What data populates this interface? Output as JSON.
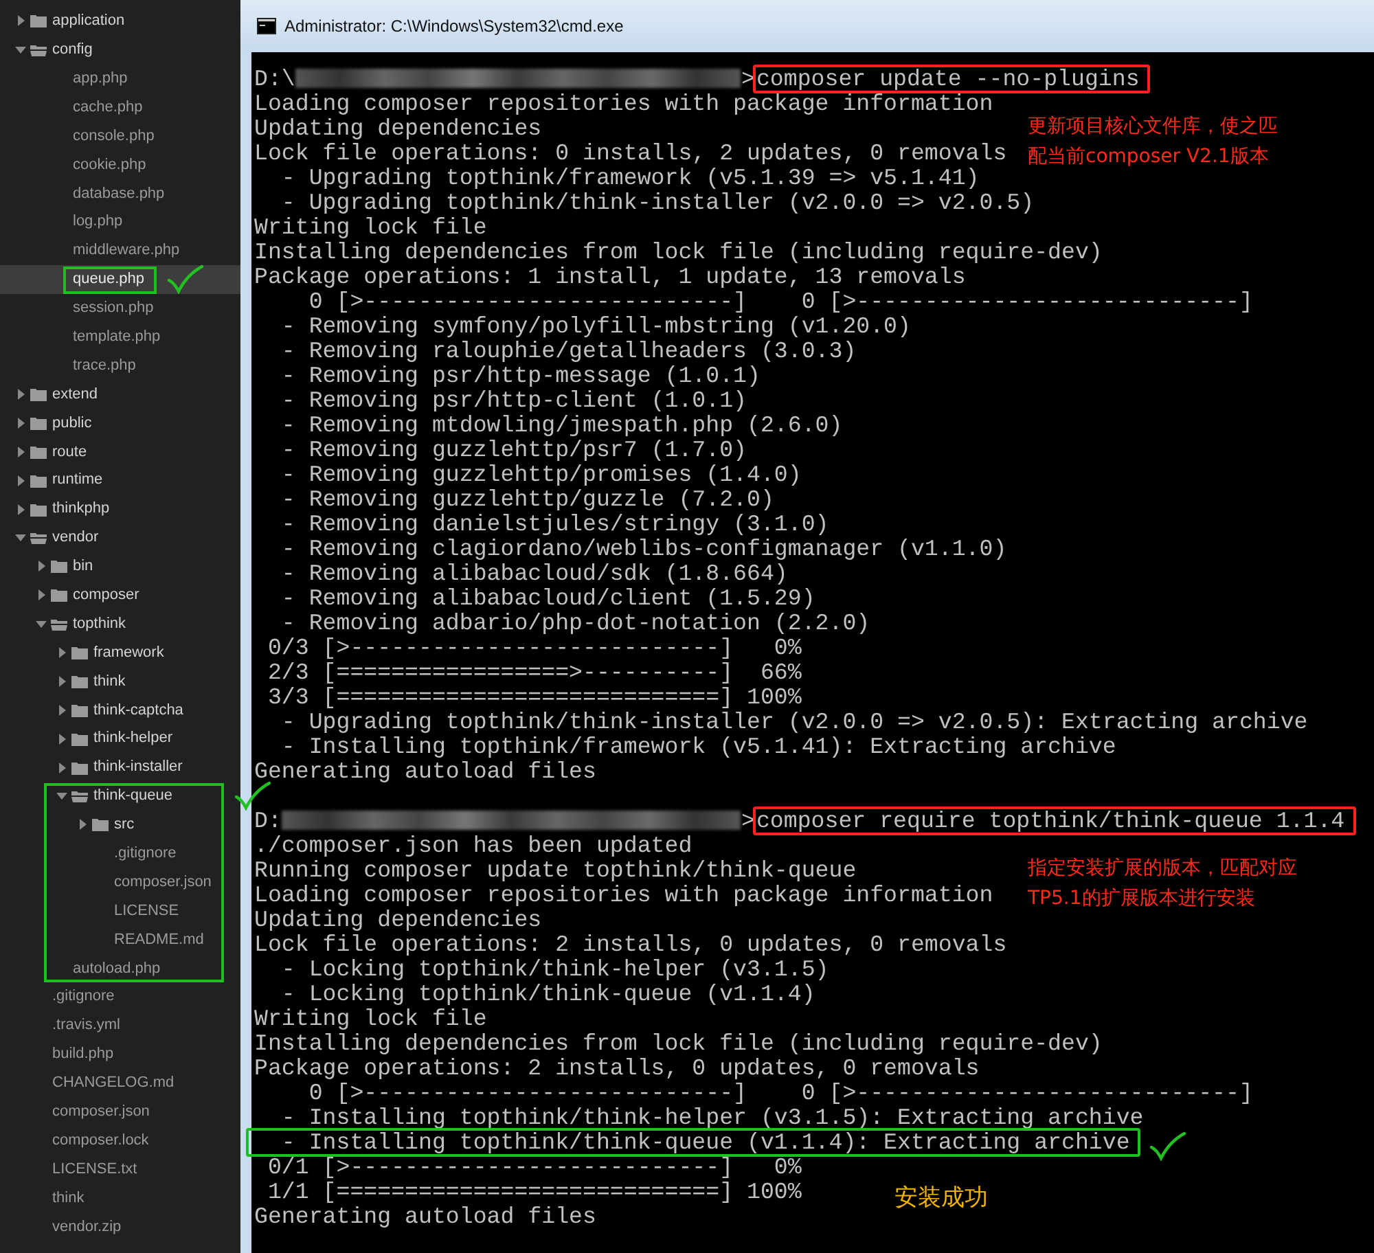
{
  "sidebar": {
    "tree": [
      {
        "name": "application",
        "kind": "folder",
        "expanded": false,
        "selected": false
      },
      {
        "name": "config",
        "kind": "folder",
        "expanded": true,
        "selected": false,
        "children": [
          {
            "name": "app.php",
            "kind": "file",
            "selected": false
          },
          {
            "name": "cache.php",
            "kind": "file",
            "selected": false
          },
          {
            "name": "console.php",
            "kind": "file",
            "selected": false
          },
          {
            "name": "cookie.php",
            "kind": "file",
            "selected": false
          },
          {
            "name": "database.php",
            "kind": "file",
            "selected": false
          },
          {
            "name": "log.php",
            "kind": "file",
            "selected": false
          },
          {
            "name": "middleware.php",
            "kind": "file",
            "selected": false
          },
          {
            "name": "queue.php",
            "kind": "file",
            "selected": true,
            "boxed": true,
            "check": true
          },
          {
            "name": "session.php",
            "kind": "file",
            "selected": false
          },
          {
            "name": "template.php",
            "kind": "file",
            "selected": false
          },
          {
            "name": "trace.php",
            "kind": "file",
            "selected": false
          }
        ]
      },
      {
        "name": "extend",
        "kind": "folder",
        "expanded": false,
        "selected": false
      },
      {
        "name": "public",
        "kind": "folder",
        "expanded": false,
        "selected": false
      },
      {
        "name": "route",
        "kind": "folder",
        "expanded": false,
        "selected": false
      },
      {
        "name": "runtime",
        "kind": "folder",
        "expanded": false,
        "selected": false
      },
      {
        "name": "thinkphp",
        "kind": "folder",
        "expanded": false,
        "selected": false
      },
      {
        "name": "vendor",
        "kind": "folder",
        "expanded": true,
        "selected": false,
        "children": [
          {
            "name": "bin",
            "kind": "folder",
            "expanded": false,
            "selected": false
          },
          {
            "name": "composer",
            "kind": "folder",
            "expanded": false,
            "selected": false
          },
          {
            "name": "topthink",
            "kind": "folder",
            "expanded": true,
            "selected": false,
            "children": [
              {
                "name": "framework",
                "kind": "folder",
                "expanded": false,
                "selected": false
              },
              {
                "name": "think",
                "kind": "folder",
                "expanded": false,
                "selected": false
              },
              {
                "name": "think-captcha",
                "kind": "folder",
                "expanded": false,
                "selected": false
              },
              {
                "name": "think-helper",
                "kind": "folder",
                "expanded": false,
                "selected": false
              },
              {
                "name": "think-installer",
                "kind": "folder",
                "expanded": false,
                "selected": false
              },
              {
                "name": "think-queue",
                "kind": "folder",
                "expanded": true,
                "selected": false,
                "boxed": true,
                "check": true,
                "children": [
                  {
                    "name": "src",
                    "kind": "folder",
                    "expanded": false,
                    "selected": false,
                    "boxed": true
                  },
                  {
                    "name": ".gitignore",
                    "kind": "file",
                    "selected": false,
                    "boxed": true
                  },
                  {
                    "name": "composer.json",
                    "kind": "file",
                    "selected": false,
                    "boxed": true
                  },
                  {
                    "name": "LICENSE",
                    "kind": "file",
                    "selected": false,
                    "boxed": true
                  },
                  {
                    "name": "README.md",
                    "kind": "file",
                    "selected": false,
                    "boxed": true
                  }
                ]
              }
            ]
          },
          {
            "name": "autoload.php",
            "kind": "file",
            "selected": false,
            "boxed": true
          }
        ]
      },
      {
        "name": ".gitignore",
        "kind": "file",
        "selected": false
      },
      {
        "name": ".travis.yml",
        "kind": "file",
        "selected": false
      },
      {
        "name": "build.php",
        "kind": "file",
        "selected": false
      },
      {
        "name": "CHANGELOG.md",
        "kind": "file",
        "selected": false
      },
      {
        "name": "composer.json",
        "kind": "file",
        "selected": false
      },
      {
        "name": "composer.lock",
        "kind": "file",
        "selected": false
      },
      {
        "name": "LICENSE.txt",
        "kind": "file",
        "selected": false
      },
      {
        "name": "think",
        "kind": "file",
        "selected": false
      },
      {
        "name": "vendor.zip",
        "kind": "file",
        "selected": false
      }
    ]
  },
  "window": {
    "title": "Administrator: C:\\Windows\\System32\\cmd.exe"
  },
  "terminal": {
    "lines": [
      {
        "kind": "prompt",
        "prompt_head": "D:\\",
        "prompt_tail": ">",
        "command": "composer update --no-plugins",
        "boxed": true,
        "color": "#ff2020"
      },
      {
        "kind": "output",
        "text": "Loading composer repositories with package information"
      },
      {
        "kind": "output",
        "text": "Updating dependencies",
        "note": {
          "kind": "remark",
          "lines": [
            "更新项目核心文件库，使之匹",
            "配当前composer V2.1版本"
          ]
        }
      },
      {
        "kind": "output",
        "text": "Lock file operations: 0 installs, 2 updates, 0 removals"
      },
      {
        "kind": "output",
        "text": "  - Upgrading topthink/framework (v5.1.39 => v5.1.41)"
      },
      {
        "kind": "output",
        "text": "  - Upgrading topthink/think-installer (v2.0.0 => v2.0.5)"
      },
      {
        "kind": "output",
        "text": "Writing lock file"
      },
      {
        "kind": "output",
        "text": "Installing dependencies from lock file (including require-dev)"
      },
      {
        "kind": "output",
        "text": "Package operations: 1 install, 1 update, 13 removals"
      },
      {
        "kind": "output",
        "text": "    0 [>---------------------------]    0 [>----------------------------]"
      },
      {
        "kind": "output",
        "text": "  - Removing symfony/polyfill-mbstring (v1.20.0)"
      },
      {
        "kind": "output",
        "text": "  - Removing ralouphie/getallheaders (3.0.3)"
      },
      {
        "kind": "output",
        "text": "  - Removing psr/http-message (1.0.1)"
      },
      {
        "kind": "output",
        "text": "  - Removing psr/http-client (1.0.1)"
      },
      {
        "kind": "output",
        "text": "  - Removing mtdowling/jmespath.php (2.6.0)"
      },
      {
        "kind": "output",
        "text": "  - Removing guzzlehttp/psr7 (1.7.0)"
      },
      {
        "kind": "output",
        "text": "  - Removing guzzlehttp/promises (1.4.0)"
      },
      {
        "kind": "output",
        "text": "  - Removing guzzlehttp/guzzle (7.2.0)"
      },
      {
        "kind": "output",
        "text": "  - Removing danielstjules/stringy (3.1.0)"
      },
      {
        "kind": "output",
        "text": "  - Removing clagiordano/weblibs-configmanager (v1.1.0)"
      },
      {
        "kind": "output",
        "text": "  - Removing alibabacloud/sdk (1.8.664)"
      },
      {
        "kind": "output",
        "text": "  - Removing alibabacloud/client (1.5.29)"
      },
      {
        "kind": "output",
        "text": "  - Removing adbario/php-dot-notation (2.2.0)"
      },
      {
        "kind": "output",
        "text": " 0/3 [>---------------------------]   0%"
      },
      {
        "kind": "output",
        "text": " 2/3 [=================>----------]  66%"
      },
      {
        "kind": "output",
        "text": " 3/3 [============================] 100%"
      },
      {
        "kind": "output",
        "text": "  - Upgrading topthink/think-installer (v2.0.0 => v2.0.5): Extracting archive"
      },
      {
        "kind": "output",
        "text": "  - Installing topthink/framework (v5.1.41): Extracting archive"
      },
      {
        "kind": "output",
        "text": "Generating autoload files"
      },
      {
        "kind": "blank"
      },
      {
        "kind": "prompt",
        "prompt_head": "D:",
        "prompt_tail": ">",
        "command": "composer require topthink/think-queue 1.1.4",
        "boxed": true,
        "color": "#ff2020"
      },
      {
        "kind": "output",
        "text": "./composer.json has been updated"
      },
      {
        "kind": "output",
        "text": "Running composer update topthink/think-queue",
        "note": {
          "kind": "remark",
          "lines": [
            "指定安装扩展的版本，匹配对应",
            "TP5.1的扩展版本进行安装"
          ]
        }
      },
      {
        "kind": "output",
        "text": "Loading composer repositories with package information"
      },
      {
        "kind": "output",
        "text": "Updating dependencies"
      },
      {
        "kind": "output",
        "text": "Lock file operations: 2 installs, 0 updates, 0 removals"
      },
      {
        "kind": "output",
        "text": "  - Locking topthink/think-helper (v3.1.5)"
      },
      {
        "kind": "output",
        "text": "  - Locking topthink/think-queue (v1.1.4)"
      },
      {
        "kind": "output",
        "text": "Writing lock file"
      },
      {
        "kind": "output",
        "text": "Installing dependencies from lock file (including require-dev)"
      },
      {
        "kind": "output",
        "text": "Package operations: 2 installs, 0 updates, 0 removals"
      },
      {
        "kind": "output",
        "text": "    0 [>---------------------------]    0 [>----------------------------]"
      },
      {
        "kind": "output",
        "text": "  - Installing topthink/think-helper (v3.1.5): Extracting archive"
      },
      {
        "kind": "output",
        "text": "  - Installing topthink/think-queue (v1.1.4): Extracting archive",
        "boxed": true,
        "color": "#1fbf1f",
        "check": true
      },
      {
        "kind": "output",
        "text": " 0/1 [>---------------------------]   0%"
      },
      {
        "kind": "output",
        "text": " 1/1 [============================] 100%",
        "note": {
          "kind": "result",
          "lines": [
            "安装成功"
          ]
        }
      },
      {
        "kind": "output",
        "text": "Generating autoload files"
      }
    ]
  }
}
